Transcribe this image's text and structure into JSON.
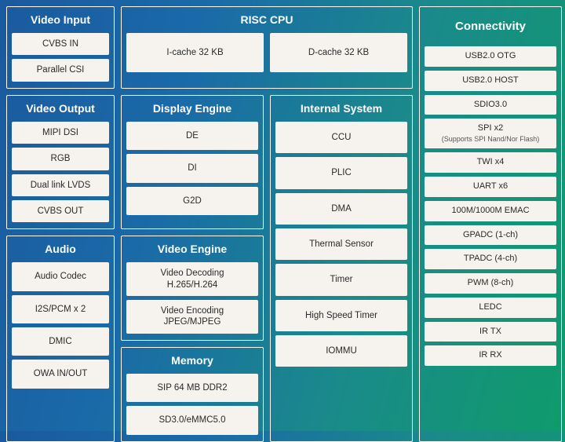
{
  "video_input": {
    "title": "Video Input",
    "items": [
      "CVBS IN",
      "Parallel CSI"
    ]
  },
  "risc_cpu": {
    "title": "RISC CPU",
    "items": [
      "I-cache 32 KB",
      "D-cache 32 KB"
    ]
  },
  "video_output": {
    "title": "Video Output",
    "items": [
      "MIPI DSI",
      "RGB",
      "Dual link LVDS",
      "CVBS OUT"
    ]
  },
  "display_engine": {
    "title": "Display Engine",
    "items": [
      "DE",
      "DI",
      "G2D"
    ]
  },
  "video_engine": {
    "title": "Video Engine",
    "items": [
      "Video Decoding\nH.265/H.264",
      "Video Encoding\nJPEG/MJPEG"
    ]
  },
  "memory": {
    "title": "Memory",
    "items": [
      "SIP 64 MB DDR2",
      "SD3.0/eMMC5.0"
    ]
  },
  "internal_system": {
    "title": "Internal System",
    "items": [
      "CCU",
      "PLIC",
      "DMA",
      "Thermal Sensor",
      "Timer",
      "High Speed Timer",
      "IOMMU"
    ]
  },
  "audio": {
    "title": "Audio",
    "items": [
      "Audio Codec",
      "I2S/PCM x 2",
      "DMIC",
      "OWA IN/OUT"
    ]
  },
  "connectivity": {
    "title": "Connectivity",
    "items": [
      "USB2.0 OTG",
      "USB2.0 HOST",
      "SDIO3.0",
      "SPI x2|(Supports SPI Nand/Nor Flash)",
      "TWI x4",
      "UART x6",
      "100M/1000M EMAC",
      "GPADC (1-ch)",
      "TPADC (4-ch)",
      "PWM (8-ch)",
      "LEDC",
      "IR TX",
      "IR RX"
    ]
  }
}
